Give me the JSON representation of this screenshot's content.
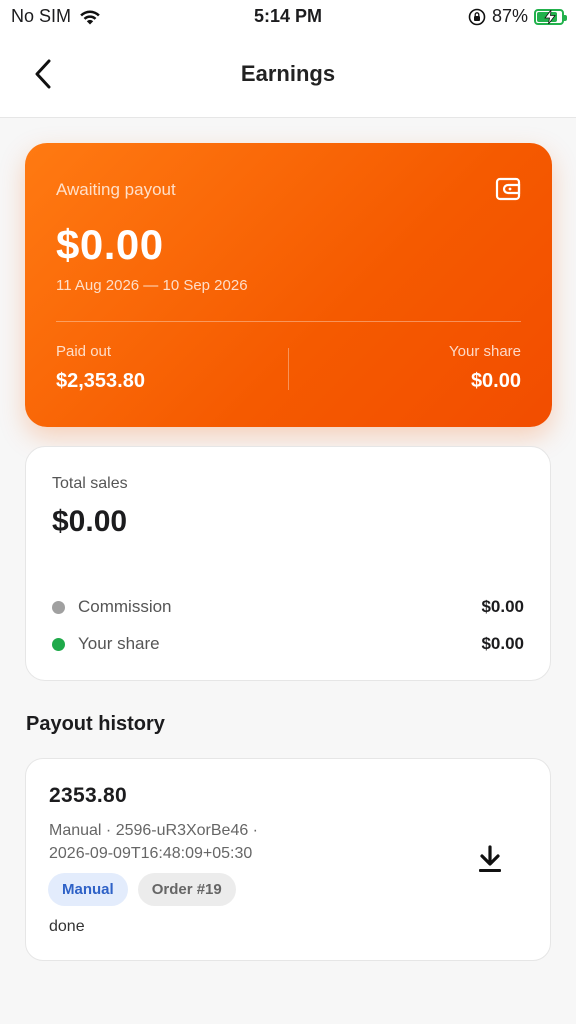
{
  "status_bar": {
    "carrier": "No SIM",
    "time": "5:14 PM",
    "battery": "87%",
    "battery_level": 0.87,
    "icons": [
      "wifi-icon",
      "orientation-lock-icon",
      "battery-charging-icon"
    ]
  },
  "nav": {
    "title": "Earnings",
    "back_icon": "chevron-left-icon"
  },
  "payout_card": {
    "label": "Awaiting payout",
    "amount": "$0.00",
    "date_range": "11 Aug 2026 — 10 Sep 2026",
    "paid_out_label": "Paid out",
    "paid_out_value": "$2,353.80",
    "share_label": "Your share",
    "share_value": "$0.00",
    "icon": "wallet-icon",
    "gradient_colors": [
      "#ff7a12",
      "#f24d00"
    ]
  },
  "sales_card": {
    "label": "Total sales",
    "amount": "$0.00",
    "rows": [
      {
        "name": "Commission",
        "value": "$0.00",
        "dot_color": "#a0a0a0"
      },
      {
        "name": "Your share",
        "value": "$0.00",
        "dot_color": "#1fa94a"
      }
    ]
  },
  "history": {
    "title": "Payout history",
    "items": [
      {
        "amount": "2353.80",
        "meta_line1": "Manual · 2596-uR3XorBe46 ·",
        "meta_line2": "2026-09-09T16:48:09+05:30",
        "chips": [
          {
            "label": "Manual",
            "color": "#2f62c7"
          },
          {
            "label": "Order #19",
            "color": "#666666"
          }
        ],
        "status": "done",
        "icon": "download-icon"
      }
    ]
  }
}
